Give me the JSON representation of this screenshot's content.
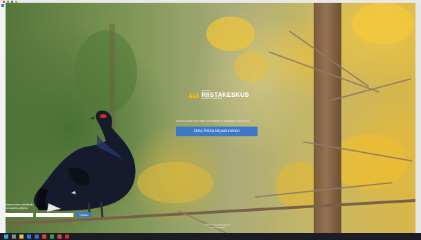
{
  "login": {
    "brand_small": "SUOMEN",
    "brand": "RIISTAKESKUS",
    "brand_sub": "FINLANDS VILTCENTRAL",
    "hint": "Kirjaudu sisään Oma Riista -tunnuksillasi tai paikallisella tunnuksella",
    "button_label": "Oma Riista kirjautuminen"
  },
  "local_login": {
    "label_1": "Kirjautuminen paikallisella",
    "label_2": "tunnuksella (ylläpito)",
    "username_placeholder": "",
    "password_placeholder": "",
    "submit_label": "Kirjaudu"
  },
  "footer": {
    "line_1": "© 2021 Suomen riistakeskus",
    "line_2": "Tietosuojaseloste"
  },
  "colors": {
    "accent": "#3c78c8",
    "logo": "#e8b520",
    "taskbar": "#1c1c24"
  },
  "taskbar_icons": [
    "start-icon",
    "search-icon",
    "folder-icon",
    "browser-icon",
    "mail-icon",
    "chrome-icon",
    "app-icon",
    "app-icon",
    "media-icon"
  ]
}
